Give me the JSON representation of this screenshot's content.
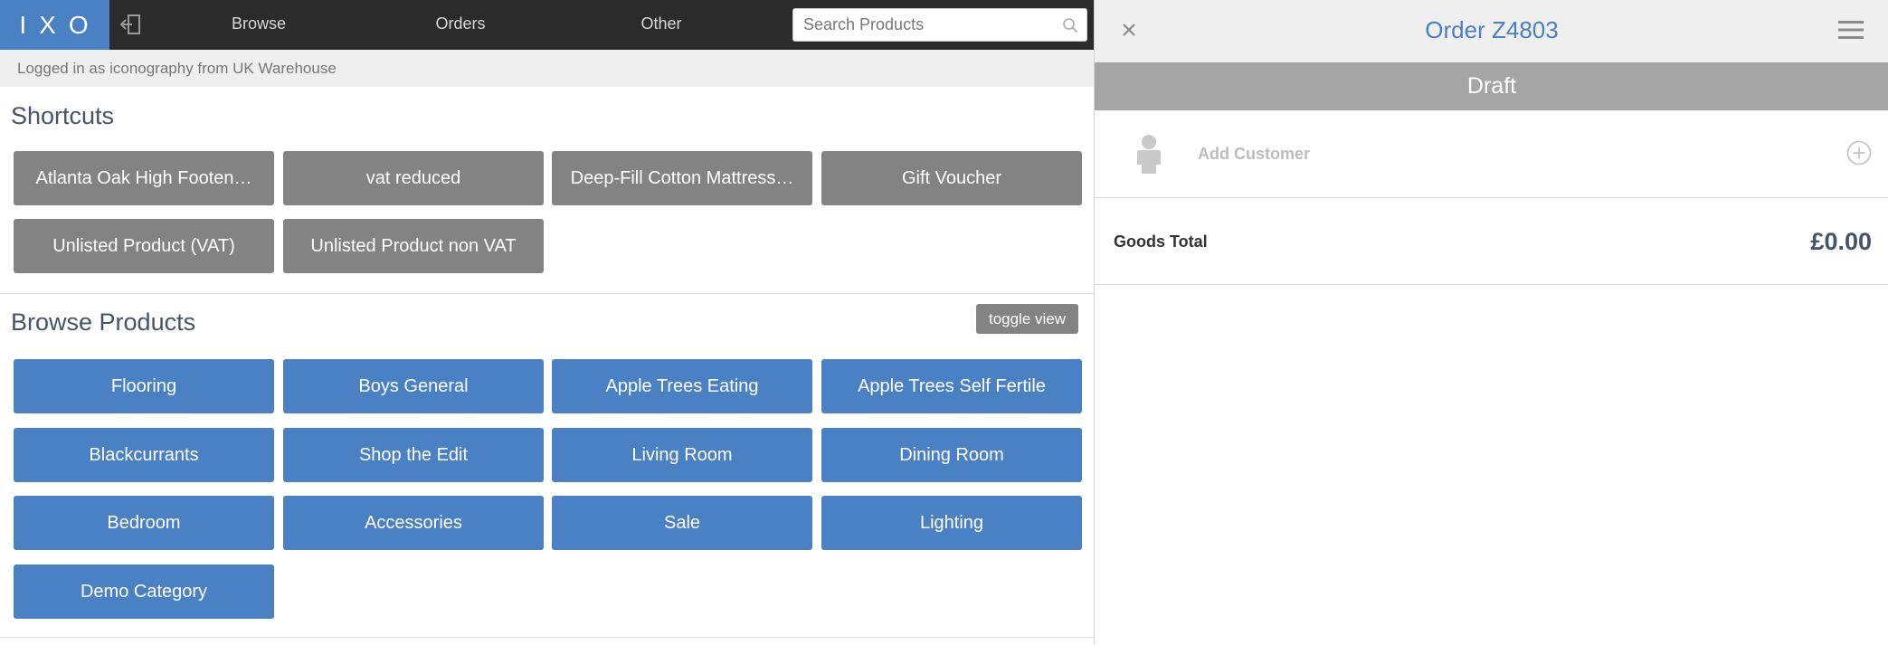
{
  "header": {
    "logo": "IXO",
    "nav": {
      "browse": "Browse",
      "orders": "Orders",
      "other": "Other"
    },
    "search": {
      "placeholder": "Search Products",
      "value": ""
    }
  },
  "session": {
    "login_text": "Logged in as iconography from UK Warehouse"
  },
  "shortcuts": {
    "title": "Shortcuts",
    "items": [
      "Atlanta Oak High Footen…",
      "vat reduced",
      "Deep-Fill Cotton Mattress…",
      "Gift Voucher",
      "Unlisted Product (VAT)",
      "Unlisted Product non VAT"
    ]
  },
  "browse": {
    "title": "Browse Products",
    "toggle_label": "toggle view",
    "categories": [
      "Flooring",
      "Boys General",
      "Apple Trees Eating",
      "Apple Trees Self Fertile",
      "Blackcurrants",
      "Shop the Edit",
      "Living Room",
      "Dining Room",
      "Bedroom",
      "Accessories",
      "Sale",
      "Lighting",
      "Demo Category"
    ]
  },
  "order": {
    "title": "Order Z4803",
    "status": "Draft",
    "add_customer_label": "Add Customer",
    "goods_total_label": "Goods Total",
    "goods_total_value": "£0.00"
  },
  "colors": {
    "accent": "#4a80c4",
    "topbar": "#2b2b2b",
    "shortcut_tile": "#838383",
    "status_bar": "#a5a5a5"
  },
  "icons": {
    "logout": "logout-arrow-icon",
    "search": "search-icon",
    "close": "close-icon",
    "menu": "hamburger-menu-icon",
    "avatar": "person-avatar-icon",
    "add": "plus-circle-icon"
  }
}
